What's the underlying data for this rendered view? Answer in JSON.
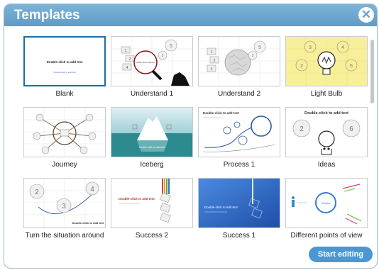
{
  "dialog": {
    "title": "Templates",
    "close_glyph": "✕",
    "start_label": "Start editing"
  },
  "templates": [
    {
      "label": "Blank",
      "thumb_text": "Double-click to add text",
      "thumb_sub": "Double-click to add text"
    },
    {
      "label": "Understand 1",
      "thumb_text": "Double-click to add text",
      "thumb_nums": [
        "5",
        "3",
        "1",
        "2",
        "4"
      ]
    },
    {
      "label": "Understand 2",
      "thumb_nums": [
        "5",
        "3",
        "1",
        "2",
        "4"
      ]
    },
    {
      "label": "Light Bulb",
      "thumb_nums": [
        "3",
        "4",
        "2",
        "5"
      ]
    },
    {
      "label": "Journey"
    },
    {
      "label": "Iceberg",
      "thumb_text": "Double-click to add text"
    },
    {
      "label": "Process 1",
      "thumb_text": "Double-click to add text"
    },
    {
      "label": "Ideas",
      "thumb_text": "Double-click to add text",
      "thumb_nums": [
        "2",
        "6"
      ]
    },
    {
      "label": "Turn the situation around",
      "thumb_text": "Double-click to add text",
      "thumb_nums": [
        "2",
        "4",
        "3"
      ]
    },
    {
      "label": "Success 2",
      "thumb_text": "Double-click to add text"
    },
    {
      "label": "Success 1",
      "thumb_text": "Double-click to add text"
    },
    {
      "label": "Different points of view",
      "thumb_text": "Subject"
    }
  ],
  "colors": {
    "title_bar": "#6aa6cf",
    "selected_border": "#1b6ea8",
    "button": "#4a97d4",
    "bulb_bg": "#f7ef9a",
    "iceberg_sea": "#2d8a8f",
    "success1_bg": "#2d6fd0"
  }
}
